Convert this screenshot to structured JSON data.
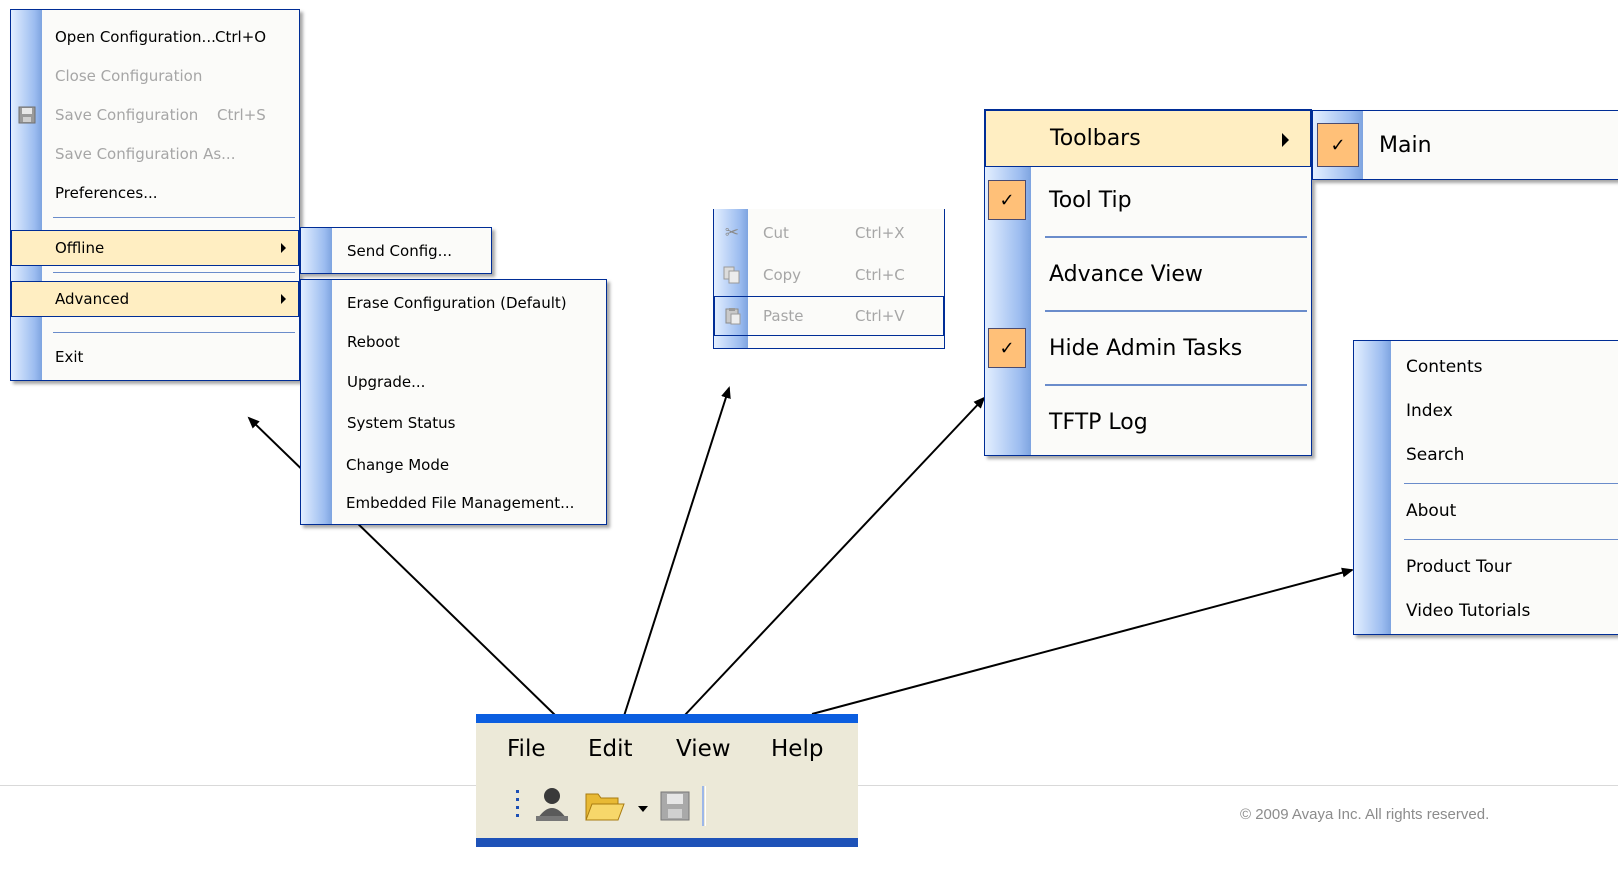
{
  "file_menu": {
    "items": [
      {
        "label": "Open Configuration...",
        "shortcut": "Ctrl+O",
        "disabled": false
      },
      {
        "label": "Close Configuration",
        "shortcut": "",
        "disabled": true
      },
      {
        "label": "Save Configuration",
        "shortcut": "Ctrl+S",
        "disabled": true,
        "icon": "floppy-disk-icon"
      },
      {
        "label": "Save  Configuration As...",
        "shortcut": "",
        "disabled": true
      },
      {
        "label": "Preferences...",
        "shortcut": "",
        "disabled": false
      },
      {
        "label": "Offline",
        "submenu": true,
        "highlighted": true
      },
      {
        "label": "Advanced",
        "submenu": true,
        "highlighted": true
      },
      {
        "label": "Exit",
        "shortcut": "",
        "disabled": false
      }
    ]
  },
  "offline_submenu": {
    "items": [
      {
        "label": "Send Config..."
      }
    ]
  },
  "advanced_submenu": {
    "items": [
      {
        "label": "Erase Configuration (Default)"
      },
      {
        "label": "Reboot"
      },
      {
        "label": "Upgrade..."
      },
      {
        "label": "System Status"
      },
      {
        "label": "Change Mode"
      },
      {
        "label": "Embedded File Management..."
      }
    ]
  },
  "edit_menu": {
    "items": [
      {
        "label": "Cut",
        "shortcut": "Ctrl+X",
        "icon": "scissors-icon",
        "disabled": true
      },
      {
        "label": "Copy",
        "shortcut": "Ctrl+C",
        "icon": "copy-icon",
        "disabled": true
      },
      {
        "label": "Paste",
        "shortcut": "Ctrl+V",
        "icon": "paste-icon",
        "disabled": true,
        "highlighted": true
      }
    ]
  },
  "view_menu": {
    "items": [
      {
        "label": "Toolbars",
        "submenu": true,
        "highlighted": true
      },
      {
        "label": "Tool Tip",
        "checked": true
      },
      {
        "label": "Advance View",
        "checked": false
      },
      {
        "label": "Hide Admin Tasks",
        "checked": true
      },
      {
        "label": "TFTP Log",
        "checked": false
      }
    ]
  },
  "toolbars_submenu": {
    "items": [
      {
        "label": "Main",
        "checked": true
      }
    ]
  },
  "help_menu": {
    "items": [
      {
        "label": "Contents"
      },
      {
        "label": "Index"
      },
      {
        "label": "Search"
      },
      {
        "label": "About"
      },
      {
        "label": "Product Tour"
      },
      {
        "label": "Video Tutorials"
      }
    ]
  },
  "menubar": {
    "items": [
      "File",
      "Edit",
      "View",
      "Help"
    ],
    "toolbar_icons": [
      "user-icon",
      "open-folder-icon",
      "dropdown-arrow-icon",
      "save-icon"
    ]
  },
  "footer": {
    "copyright": "© 2009 Avaya Inc. All rights reserved."
  },
  "colors": {
    "menu_border": "#002d96",
    "highlight": "#ffeec2",
    "check_bg": "#ffc078",
    "gutter": "#9dbdf0",
    "menubar_blue": "#0b5ee0"
  },
  "glyphs": {
    "check": "✓"
  }
}
